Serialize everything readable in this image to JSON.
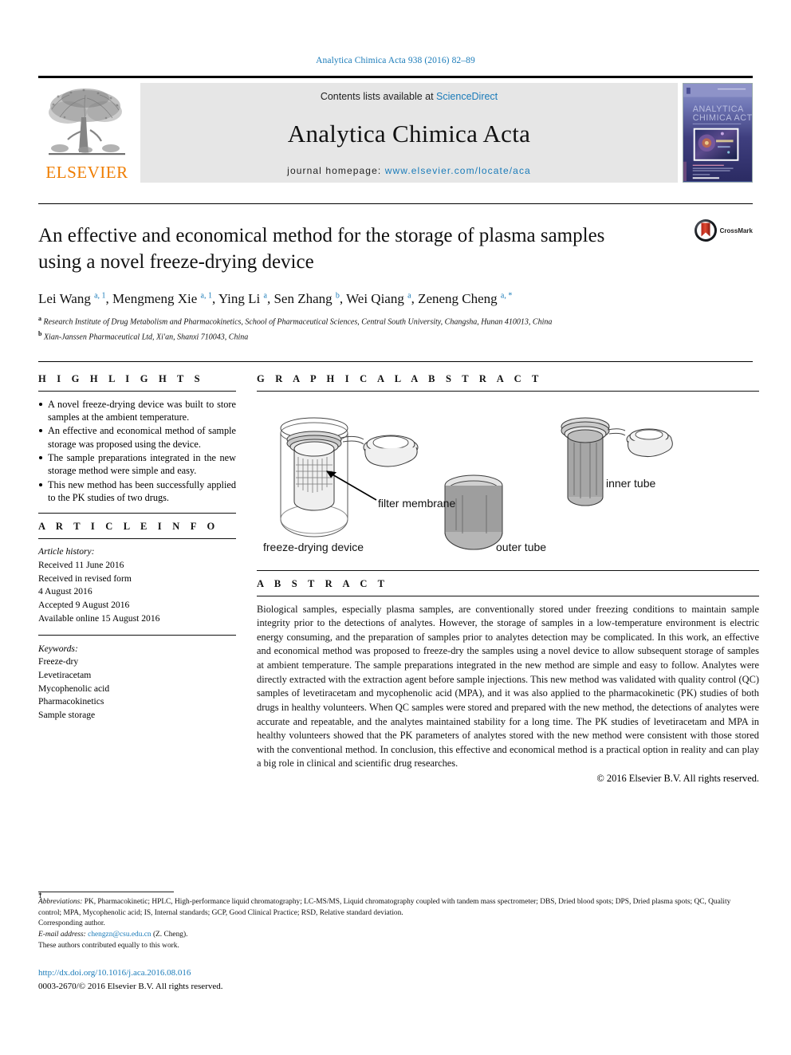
{
  "running_head": "Analytica Chimica Acta 938 (2016) 82–89",
  "masthead": {
    "publisher": "ELSEVIER",
    "contents_prefix": "Contents lists available at ",
    "contents_link": "ScienceDirect",
    "journal_title": "Analytica Chimica Acta",
    "homepage_prefix": "journal homepage: ",
    "homepage_link": "www.elsevier.com/locate/aca",
    "cover_title_line1": "ANALYTICA",
    "cover_title_line2": "CHIMICA ACTA",
    "accent_orange": "#ef7d00",
    "link_blue": "#1a7bb9",
    "band_gray": "#e6e6e6"
  },
  "article": {
    "title": "An effective and economical method for the storage of plasma samples using a novel freeze-drying device",
    "crossmark_label": "CrossMark",
    "authors_html": "Lei Wang <sup>a, 1</sup>, Mengmeng Xie <sup>a, 1</sup>, Ying Li <sup>a</sup>, Sen Zhang <sup>b</sup>, Wei Qiang <sup>a</sup>, Zeneng Cheng <sup>a, *</sup>",
    "affiliation_a": "Research Institute of Drug Metabolism and Pharmacokinetics, School of Pharmaceutical Sciences, Central South University, Changsha, Hunan 410013, China",
    "affiliation_b": "Xian-Janssen Pharmaceutical Ltd, Xi'an, Shanxi 710043, China"
  },
  "highlights": {
    "heading": "H I G H L I G H T S",
    "items": [
      "A novel freeze-drying device was built to store samples at the ambient temperature.",
      "An effective and economical method of sample storage was proposed using the device.",
      "The sample preparations integrated in the new storage method were simple and easy.",
      "This new method has been successfully applied to the PK studies of two drugs."
    ]
  },
  "article_info": {
    "heading": "A R T I C L E   I N F O",
    "history_label": "Article history:",
    "history": [
      "Received 11 June 2016",
      "Received in revised form",
      "4 August 2016",
      "Accepted 9 August 2016",
      "Available online 15 August 2016"
    ],
    "keywords_label": "Keywords:",
    "keywords": [
      "Freeze-dry",
      "Levetiracetam",
      "Mycophenolic acid",
      "Pharmacokinetics",
      "Sample storage"
    ]
  },
  "graphical_abstract": {
    "heading": "G R A P H I C A L   A B S T R A C T",
    "labels": {
      "filter_membrane": "filter membrane",
      "freeze_drying_device": "freeze-drying device",
      "outer_tube": "outer tube",
      "inner_tube": "inner tube"
    }
  },
  "abstract": {
    "heading": "A B S T R A C T",
    "body": "Biological samples, especially plasma samples, are conventionally stored under freezing conditions to maintain sample integrity prior to the detections of analytes. However, the storage of samples in a low-temperature environment is electric energy consuming, and the preparation of samples prior to analytes detection may be complicated. In this work, an effective and economical method was proposed to freeze-dry the samples using a novel device to allow subsequent storage of samples at ambient temperature. The sample preparations integrated in the new method are simple and easy to follow. Analytes were directly extracted with the extraction agent before sample injections. This new method was validated with quality control (QC) samples of levetiracetam and mycophenolic acid (MPA), and it was also applied to the pharmacokinetic (PK) studies of both drugs in healthy volunteers. When QC samples were stored and prepared with the new method, the detections of analytes were accurate and repeatable, and the analytes maintained stability for a long time. The PK studies of levetiracetam and MPA in healthy volunteers showed that the PK parameters of analytes stored with the new method were consistent with those stored with the conventional method. In conclusion, this effective and economical method is a practical option in reality and can play a big role in clinical and scientific drug researches.",
    "copyright": "© 2016 Elsevier B.V. All rights reserved."
  },
  "footnotes": {
    "abbreviations_label": "Abbreviations:",
    "abbreviations_text": " PK, Pharmacokinetic; HPLC, High-performance liquid chromatography; LC-MS/MS, Liquid chromatography coupled with tandem mass spectrometer; DBS, Dried blood spots; DPS, Dried plasma spots; QC, Quality control; MPA, Mycophenolic acid; IS, Internal standards; GCP, Good Clinical Practice; RSD, Relative standard deviation.",
    "corresponding_mark": "*",
    "corresponding_text": "Corresponding author.",
    "email_label": "E-mail address:",
    "email": "chengzn@csu.edu.cn",
    "email_suffix": " (Z. Cheng).",
    "equal_mark": "1",
    "equal_text": "These authors contributed equally to this work."
  },
  "bottom": {
    "doi": "http://dx.doi.org/10.1016/j.aca.2016.08.016",
    "issn_line": "0003-2670/© 2016 Elsevier B.V. All rights reserved."
  }
}
